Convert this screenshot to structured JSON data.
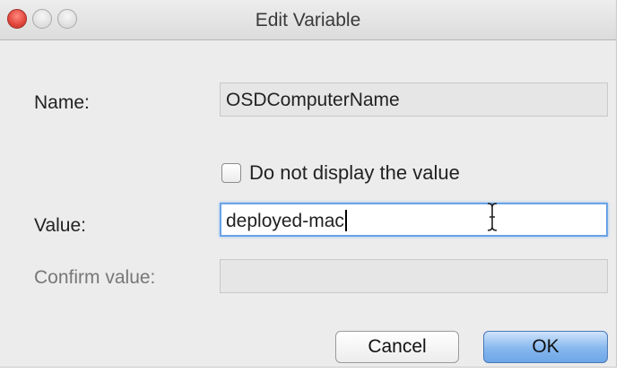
{
  "window": {
    "title": "Edit Variable"
  },
  "form": {
    "name_label": "Name:",
    "name_value": "OSDComputerName",
    "hide_value_checkbox_label": "Do not display the value",
    "hide_value_checked": false,
    "value_label": "Value:",
    "value_value": "deployed-mac",
    "confirm_label": "Confirm value:",
    "confirm_value": ""
  },
  "buttons": {
    "cancel_label": "Cancel",
    "ok_label": "OK"
  },
  "colors": {
    "close_button": "#e1443a",
    "focus_ring": "#6aa3e6",
    "default_button": "#86b7ee"
  },
  "icons": {
    "cursor": "text-cursor-icon"
  }
}
